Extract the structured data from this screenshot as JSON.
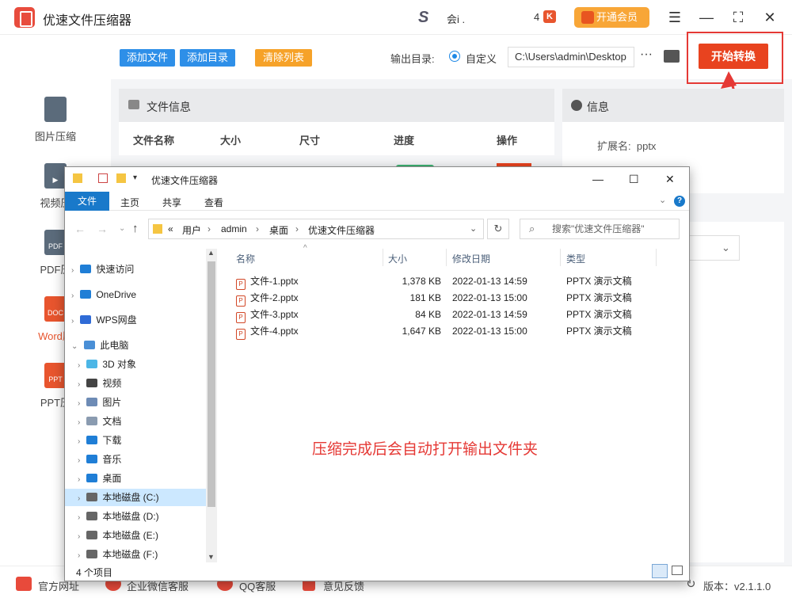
{
  "app": {
    "title": "优速文件压缩器",
    "user_name": "会i .",
    "points": "4",
    "vip_label": "开通会员"
  },
  "toolbar": {
    "add_file": "添加文件",
    "add_dir": "添加目录",
    "clear": "清除列表",
    "output_label": "输出目录:",
    "custom": "自定义",
    "output_path": "C:\\Users\\admin\\Desktop",
    "more": "···",
    "start": "开始转换"
  },
  "sidebar": {
    "items": [
      {
        "label": "图片压缩",
        "icon": "image-file-icon",
        "color": "#5b6b7b",
        "badge": ""
      },
      {
        "label": "视频压",
        "icon": "video-file-icon",
        "color": "#5b6b7b",
        "badge": "▶"
      },
      {
        "label": "PDF压",
        "icon": "pdf-file-icon",
        "color": "#5b6b7b",
        "badge": "PDF"
      },
      {
        "label": "Word压",
        "icon": "word-file-icon",
        "color": "#e8552e",
        "badge": "DOC"
      },
      {
        "label": "PPT压",
        "icon": "ppt-file-icon",
        "color": "#e8552e",
        "badge": "PPT"
      }
    ]
  },
  "fileinfo": {
    "title": "文件信息",
    "columns": [
      "文件名称",
      "大小",
      "尺寸",
      "进度",
      "操作"
    ]
  },
  "info": {
    "title": "信息",
    "ext_label": "扩展名:",
    "ext_value": "pptx"
  },
  "bottom": {
    "links": [
      "官方网址",
      "企业微信客服",
      "QQ客服",
      "意见反馈"
    ],
    "version": "版本：v2.1.1.0"
  },
  "explorer": {
    "title": "优速文件压缩器",
    "ribbon": [
      "文件",
      "主页",
      "共享",
      "查看"
    ],
    "breadcrumb": [
      "«",
      "用户",
      "admin",
      "桌面",
      "优速文件压缩器"
    ],
    "search_placeholder": "搜索\"优速文件压缩器\"",
    "nav": [
      {
        "label": "快速访问",
        "icon": "star-icon",
        "level": 0,
        "color": "#1f7ed6"
      },
      {
        "label": "OneDrive",
        "icon": "cloud-icon",
        "level": 0,
        "color": "#1f7ed6"
      },
      {
        "label": "WPS网盘",
        "icon": "wps-cloud-icon",
        "level": 0,
        "color": "#2f6bd6"
      },
      {
        "label": "此电脑",
        "icon": "computer-icon",
        "level": 0,
        "color": "#4a8fd6"
      },
      {
        "label": "3D 对象",
        "icon": "cube-icon",
        "level": 1,
        "color": "#4cb6e6"
      },
      {
        "label": "视频",
        "icon": "film-icon",
        "level": 1,
        "color": "#444444"
      },
      {
        "label": "图片",
        "icon": "picture-icon",
        "level": 1,
        "color": "#6d8bb5"
      },
      {
        "label": "文档",
        "icon": "document-icon",
        "level": 1,
        "color": "#8a9bb0"
      },
      {
        "label": "下载",
        "icon": "download-icon",
        "level": 1,
        "color": "#1f7ed6"
      },
      {
        "label": "音乐",
        "icon": "music-icon",
        "level": 1,
        "color": "#1f7ed6"
      },
      {
        "label": "桌面",
        "icon": "desktop-icon",
        "level": 1,
        "color": "#1f7ed6"
      },
      {
        "label": "本地磁盘 (C:)",
        "icon": "drive-c-icon",
        "level": 1,
        "color": "#666666",
        "selected": true
      },
      {
        "label": "本地磁盘 (D:)",
        "icon": "drive-icon",
        "level": 1,
        "color": "#666666"
      },
      {
        "label": "本地磁盘 (E:)",
        "icon": "drive-icon",
        "level": 1,
        "color": "#666666"
      },
      {
        "label": "本地磁盘 (F:)",
        "icon": "drive-icon",
        "level": 1,
        "color": "#666666"
      }
    ],
    "columns": [
      "名称",
      "大小",
      "修改日期",
      "类型"
    ],
    "files": [
      {
        "name": "文件-1.pptx",
        "size": "1,378 KB",
        "date": "2022-01-13 14:59",
        "type": "PPTX 演示文稿"
      },
      {
        "name": "文件-2.pptx",
        "size": "181 KB",
        "date": "2022-01-13 15:00",
        "type": "PPTX 演示文稿"
      },
      {
        "name": "文件-3.pptx",
        "size": "84 KB",
        "date": "2022-01-13 14:59",
        "type": "PPTX 演示文稿"
      },
      {
        "name": "文件-4.pptx",
        "size": "1,647 KB",
        "date": "2022-01-13 15:00",
        "type": "PPTX 演示文稿"
      }
    ],
    "hint": "压缩完成后会自动打开输出文件夹",
    "status": "4 个项目"
  }
}
